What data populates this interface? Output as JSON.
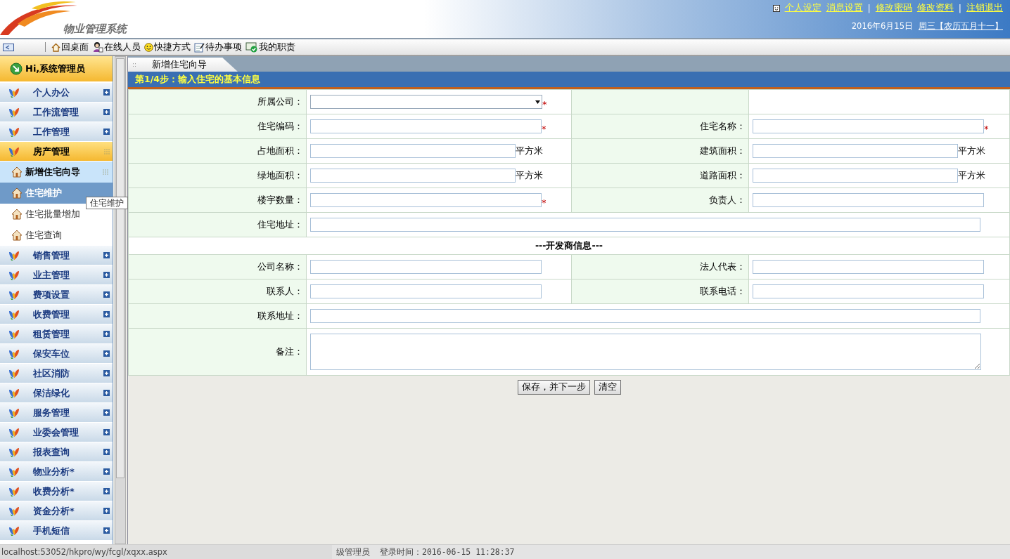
{
  "header": {
    "title": "物业管理系统",
    "links": [
      {
        "kind": "link",
        "label": "个人设定"
      },
      {
        "kind": "link",
        "label": "消息设置"
      },
      {
        "kind": "separator",
        "label": "|"
      },
      {
        "kind": "link",
        "label": "修改密码"
      },
      {
        "kind": "link",
        "label": "修改资料"
      },
      {
        "kind": "separator",
        "label": "|"
      },
      {
        "kind": "link",
        "label": "注销退出"
      }
    ],
    "date": "2016年6月15日",
    "weekday": "周三【农历五月十一】"
  },
  "toolbar": [
    {
      "label": "回桌面"
    },
    {
      "label": "在线人员"
    },
    {
      "label": "快捷方式"
    },
    {
      "label": "待办事项"
    },
    {
      "label": "我的职责"
    }
  ],
  "sidebar": {
    "greeting": "Hi,系统管理员",
    "groups": [
      {
        "label": "个人办公",
        "expanded": false
      },
      {
        "label": "工作流管理",
        "expanded": false
      },
      {
        "label": "工作管理",
        "expanded": false
      },
      {
        "label": "房产管理",
        "expanded": true,
        "children": [
          {
            "label": "新增住宅向导",
            "selected": true,
            "hovered": false
          },
          {
            "label": "住宅维护",
            "selected": false,
            "hovered": true
          },
          {
            "label": "住宅批量增加",
            "selected": false,
            "hovered": false
          },
          {
            "label": "住宅查询",
            "selected": false,
            "hovered": false
          }
        ]
      },
      {
        "label": "销售管理",
        "expanded": false
      },
      {
        "label": "业主管理",
        "expanded": false
      },
      {
        "label": "费项设置",
        "expanded": false
      },
      {
        "label": "收费管理",
        "expanded": false
      },
      {
        "label": "租赁管理",
        "expanded": false
      },
      {
        "label": "保安车位",
        "expanded": false
      },
      {
        "label": "社区消防",
        "expanded": false
      },
      {
        "label": "保洁绿化",
        "expanded": false
      },
      {
        "label": "服务管理",
        "expanded": false
      },
      {
        "label": "业委会管理",
        "expanded": false
      },
      {
        "label": "报表查询",
        "expanded": false
      },
      {
        "label": "物业分析*",
        "expanded": false
      },
      {
        "label": "收费分析*",
        "expanded": false
      },
      {
        "label": "资金分析*",
        "expanded": false
      },
      {
        "label": "手机短信",
        "expanded": false
      }
    ],
    "tooltip": "住宅维护"
  },
  "tab": {
    "grip": "::",
    "label": "新增住宅向导",
    "selected": true
  },
  "step_title": "第1/4步：输入住宅的基本信息",
  "form": {
    "rows": [
      {
        "kind": "pair",
        "fields": [
          {
            "label": "所属公司：",
            "kind": "select",
            "required": true
          }
        ]
      },
      {
        "kind": "pair",
        "fields": [
          {
            "label": "住宅编码：",
            "kind": "text",
            "required": true
          },
          {
            "label": "住宅名称：",
            "kind": "text",
            "required": true
          }
        ]
      },
      {
        "kind": "pair",
        "fields": [
          {
            "label": "占地面积：",
            "kind": "text",
            "required": false,
            "unit": "平方米"
          },
          {
            "label": "建筑面积：",
            "kind": "text",
            "required": false,
            "unit": "平方米"
          }
        ]
      },
      {
        "kind": "pair",
        "fields": [
          {
            "label": "绿地面积：",
            "kind": "text",
            "required": false,
            "unit": "平方米"
          },
          {
            "label": "道路面积：",
            "kind": "text",
            "required": false,
            "unit": "平方米"
          }
        ]
      },
      {
        "kind": "pair",
        "fields": [
          {
            "label": "楼宇数量：",
            "kind": "text",
            "required": true
          },
          {
            "label": "负责人：",
            "kind": "text",
            "required": false
          }
        ]
      },
      {
        "kind": "wide",
        "fields": [
          {
            "label": "住宅地址：",
            "kind": "text",
            "required": false
          }
        ]
      },
      {
        "kind": "section",
        "title": "---开发商信息---"
      },
      {
        "kind": "pair",
        "fields": [
          {
            "label": "公司名称：",
            "kind": "text",
            "required": false
          },
          {
            "label": "法人代表：",
            "kind": "text",
            "required": false
          }
        ]
      },
      {
        "kind": "pair",
        "fields": [
          {
            "label": "联系人：",
            "kind": "text",
            "required": false
          },
          {
            "label": "联系电话：",
            "kind": "text",
            "required": false
          }
        ]
      },
      {
        "kind": "wide",
        "fields": [
          {
            "label": "联系地址：",
            "kind": "text",
            "required": false
          }
        ]
      },
      {
        "kind": "wide",
        "fields": [
          {
            "label": "备注：",
            "kind": "textarea",
            "required": false
          }
        ]
      }
    ],
    "required_mark": "*",
    "buttons": [
      "保存，并下一步",
      "清空"
    ]
  },
  "status_bar": {
    "url": "localhost:53052/hkpro/wy/fcgl/xqxx.aspx",
    "user": "级管理员",
    "login": "登录时间：2016-06-15 11:28:37"
  }
}
